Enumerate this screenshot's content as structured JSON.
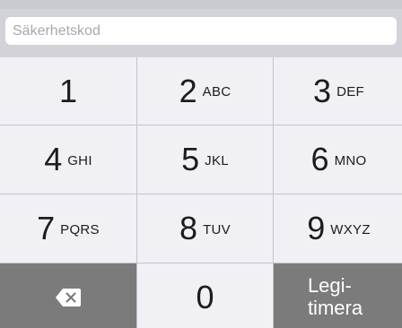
{
  "passcode_field": {
    "placeholder": "Säkerhetskod",
    "value": ""
  },
  "keypad": {
    "keys": [
      {
        "digit": "1",
        "letters": ""
      },
      {
        "digit": "2",
        "letters": "ABC"
      },
      {
        "digit": "3",
        "letters": "DEF"
      },
      {
        "digit": "4",
        "letters": "GHI"
      },
      {
        "digit": "5",
        "letters": "JKL"
      },
      {
        "digit": "6",
        "letters": "MNO"
      },
      {
        "digit": "7",
        "letters": "PQRS"
      },
      {
        "digit": "8",
        "letters": "TUV"
      },
      {
        "digit": "9",
        "letters": "WXYZ"
      }
    ],
    "zero_digit": "0",
    "backspace_icon": "backspace-icon",
    "submit_label": "Legi-\ntimera"
  },
  "colors": {
    "keypad_bg": "#f0f0f5",
    "dark_key_bg": "#7b7b7b",
    "background": "#d1d3d9"
  }
}
